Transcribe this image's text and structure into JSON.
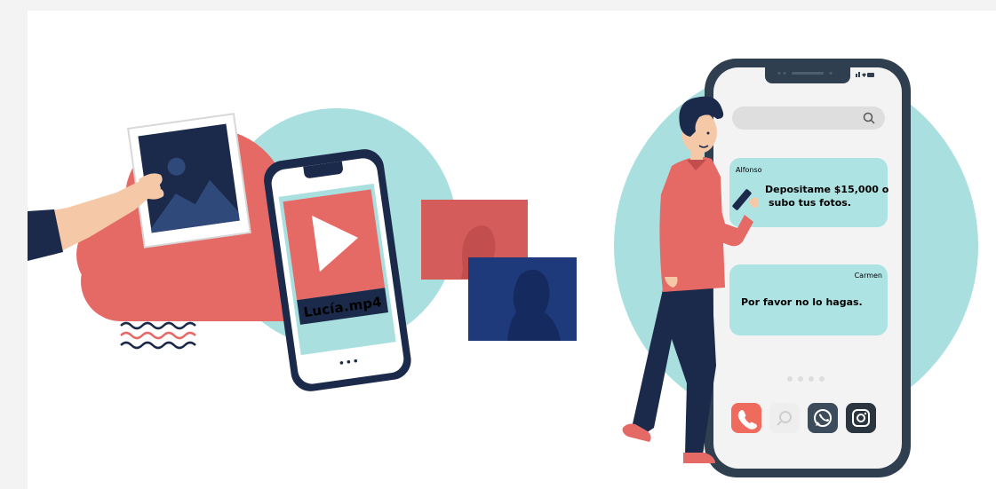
{
  "illustration": {
    "video_file_label": "Lucía.mp4",
    "chat": {
      "messages": [
        {
          "sender": "Alfonso",
          "text_line1": "Depositame $15,000 o",
          "text_line2": "subo tus fotos."
        },
        {
          "sender": "Carmen",
          "text_line1": "Por favor no lo hagas.",
          "text_line2": ""
        }
      ]
    },
    "dock_icons": [
      "phone-icon",
      "search-icon",
      "whatsapp-icon",
      "instagram-icon"
    ],
    "colors": {
      "teal": "#a9e0df",
      "coral": "#e56a66",
      "navy": "#1b2a4a",
      "phone_frame": "#2f3f4f",
      "bubble": "#aee3e3"
    }
  }
}
